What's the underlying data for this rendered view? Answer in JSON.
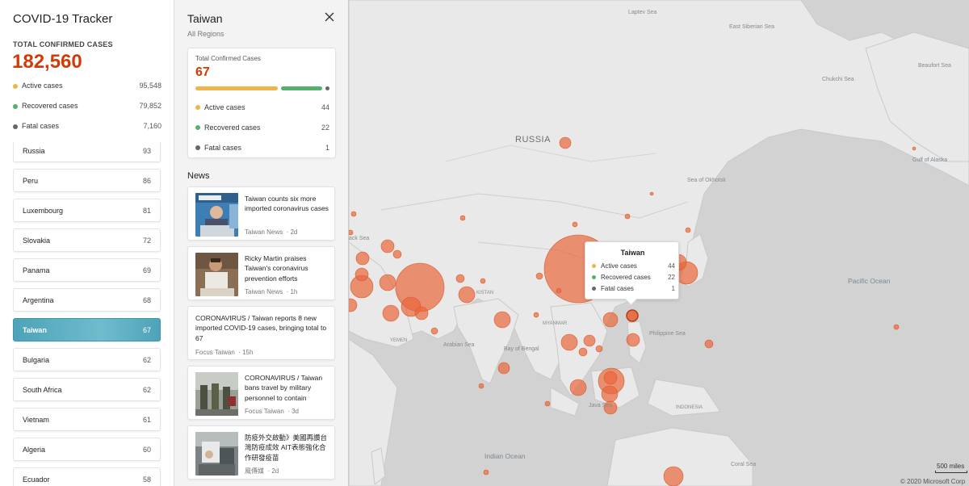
{
  "sidebar": {
    "title": "COVID-19 Tracker",
    "total_label": "TOTAL CONFIRMED CASES",
    "total_value": "182,560",
    "stats": [
      {
        "label": "Active cases",
        "value": "95,548",
        "color": "#f0b34a"
      },
      {
        "label": "Recovered cases",
        "value": "79,852",
        "color": "#54b06b"
      },
      {
        "label": "Fatal cases",
        "value": "7,160",
        "color": "#666666"
      }
    ],
    "countries": [
      {
        "name": "Russia",
        "count": "93"
      },
      {
        "name": "Peru",
        "count": "86"
      },
      {
        "name": "Luxembourg",
        "count": "81"
      },
      {
        "name": "Slovakia",
        "count": "72"
      },
      {
        "name": "Panama",
        "count": "69"
      },
      {
        "name": "Argentina",
        "count": "68"
      },
      {
        "name": "Taiwan",
        "count": "67",
        "selected": true
      },
      {
        "name": "Bulgaria",
        "count": "62"
      },
      {
        "name": "South Africa",
        "count": "62"
      },
      {
        "name": "Vietnam",
        "count": "61"
      },
      {
        "name": "Algeria",
        "count": "60"
      },
      {
        "name": "Ecuador",
        "count": "58"
      }
    ]
  },
  "detail": {
    "title": "Taiwan",
    "subtitle": "All Regions",
    "close_icon": "close-icon",
    "summary_label": "Total Confirmed Cases",
    "summary_value": "67",
    "breakdown": {
      "active": 44,
      "recovered": 22,
      "fatal": 1
    },
    "stats": [
      {
        "label": "Active cases",
        "value": "44",
        "color": "#f0b34a"
      },
      {
        "label": "Recovered cases",
        "value": "22",
        "color": "#54b06b"
      },
      {
        "label": "Fatal cases",
        "value": "1",
        "color": "#666666"
      }
    ],
    "news_heading": "News",
    "news": [
      {
        "title": "Taiwan counts six more imported coronavirus cases",
        "source": "Taiwan News",
        "time": "2d",
        "thumb": "press-conference-photo"
      },
      {
        "title": "Ricky Martin praises Taiwan's coronavirus prevention efforts",
        "source": "Taiwan News",
        "time": "1h",
        "thumb": "portrait-photo"
      },
      {
        "title": "CORONAVIRUS / Taiwan reports 8 new imported COVID-19 cases, bringing total to 67",
        "source": "Focus Taiwan",
        "time": "15h",
        "thumb": null
      },
      {
        "title": "CORONAVIRUS / Taiwan bans travel by military personnel to contain",
        "source": "Focus Taiwan",
        "time": "3d",
        "thumb": "soldiers-photo"
      },
      {
        "title": "防疫外交啟動》美國再讚台灣防疫成效 AIT表態強化合作研發疫苗",
        "source": "風傳媒",
        "time": "2d",
        "thumb": "lab-photo"
      }
    ]
  },
  "map": {
    "labels": [
      {
        "text": "RUSSIA",
        "kind": "country"
      },
      {
        "text": "Laptev Sea",
        "kind": "sea"
      },
      {
        "text": "East Siberian Sea",
        "kind": "sea"
      },
      {
        "text": "Beaufort Sea",
        "kind": "sea"
      },
      {
        "text": "Chukchi Sea",
        "kind": "sea"
      },
      {
        "text": "Sea of Okhotsk",
        "kind": "sea"
      },
      {
        "text": "Gulf of Alaska",
        "kind": "sea"
      },
      {
        "text": "Pacific Ocean",
        "kind": "ocean"
      },
      {
        "text": "Philippine Sea",
        "kind": "sea"
      },
      {
        "text": "Arabian Sea",
        "kind": "sea"
      },
      {
        "text": "Bay of Bengal",
        "kind": "sea"
      },
      {
        "text": "Indian Ocean",
        "kind": "ocean"
      },
      {
        "text": "Java Sea",
        "kind": "sea"
      },
      {
        "text": "Coral Sea",
        "kind": "sea"
      },
      {
        "text": "ack Sea",
        "kind": "sea"
      },
      {
        "text": "YEMEN",
        "kind": "small"
      },
      {
        "text": "KISTAN",
        "kind": "small"
      },
      {
        "text": "MYANMAR",
        "kind": "small"
      },
      {
        "text": "INDONESIA",
        "kind": "small"
      }
    ],
    "tooltip": {
      "title": "Taiwan",
      "rows": [
        {
          "label": "Active cases",
          "value": "44",
          "color": "#f0b34a"
        },
        {
          "label": "Recovered cases",
          "value": "22",
          "color": "#54b06b"
        },
        {
          "label": "Fatal cases",
          "value": "1",
          "color": "#666666"
        }
      ]
    },
    "scale": "500 miles",
    "copyright": "© 2020 Microsoft Corp",
    "bubble_color": "#e8663a"
  }
}
